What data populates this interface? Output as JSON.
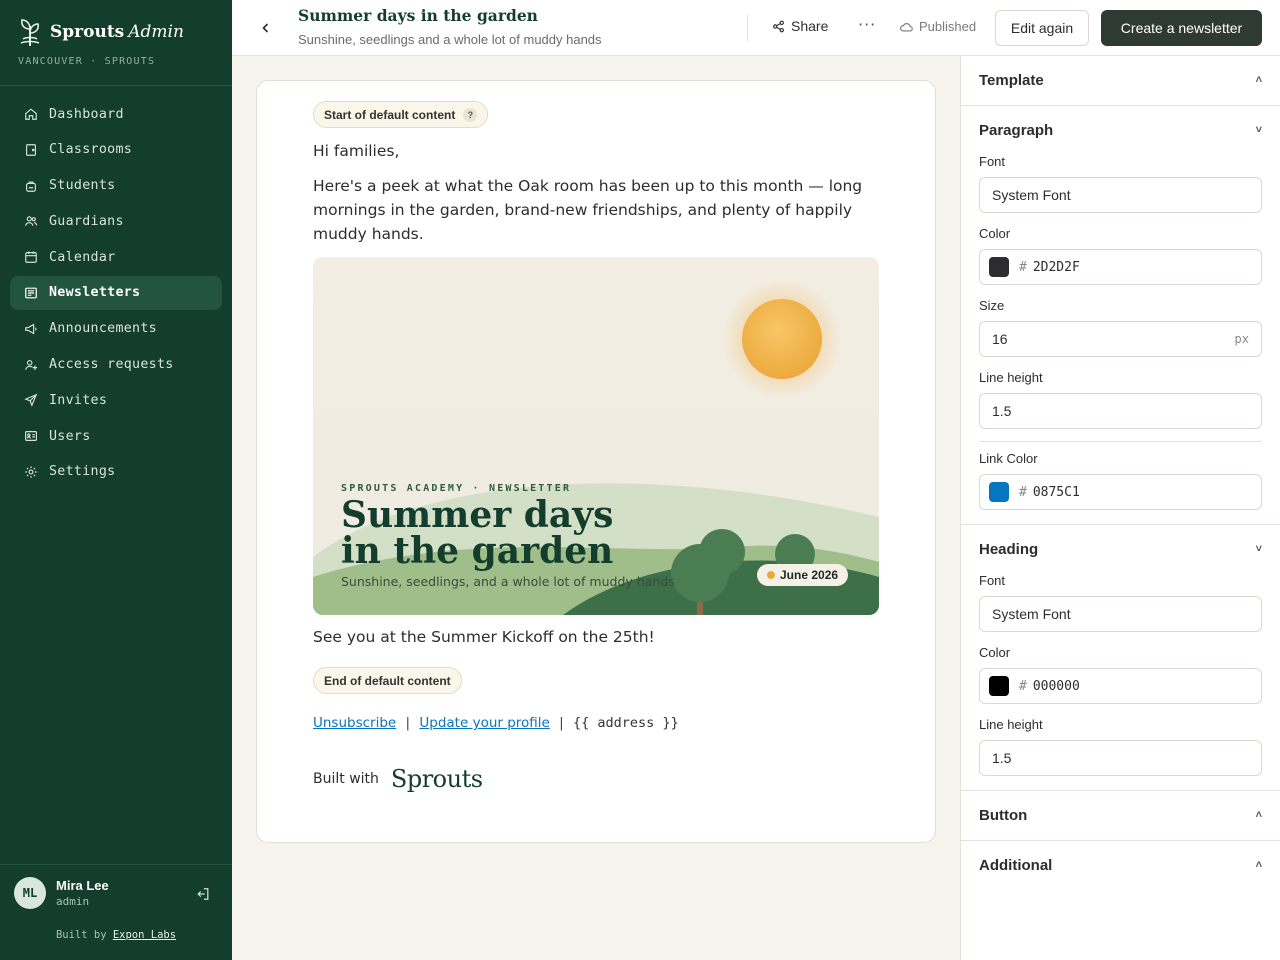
{
  "brand": {
    "name": "Sprouts",
    "name_suffix": "Admin",
    "location": "VANCOUVER · SPROUTS"
  },
  "sidebar": {
    "items": [
      {
        "label": "Dashboard",
        "icon": "home-icon",
        "active": false
      },
      {
        "label": "Classrooms",
        "icon": "door-icon",
        "active": false
      },
      {
        "label": "Students",
        "icon": "backpack-icon",
        "active": false
      },
      {
        "label": "Guardians",
        "icon": "users-icon",
        "active": false
      },
      {
        "label": "Calendar",
        "icon": "calendar-icon",
        "active": false
      },
      {
        "label": "Newsletters",
        "icon": "newspaper-icon",
        "active": true
      },
      {
        "label": "Announcements",
        "icon": "megaphone-icon",
        "active": false
      },
      {
        "label": "Access requests",
        "icon": "user-plus-icon",
        "active": false
      },
      {
        "label": "Invites",
        "icon": "send-icon",
        "active": false
      },
      {
        "label": "Users",
        "icon": "id-card-icon",
        "active": false
      },
      {
        "label": "Settings",
        "icon": "gear-icon",
        "active": false
      }
    ]
  },
  "user": {
    "initials": "ML",
    "name": "Mira Lee",
    "role": "admin"
  },
  "footer": {
    "built_by": "Built by",
    "company": "Expon Labs"
  },
  "header": {
    "title": "Summer days in the garden",
    "subtitle": "Sunshine, seedlings and a whole lot of muddy hands",
    "share_label": "Share",
    "more_label": "···",
    "status_label": "Published",
    "edit_label": "Edit again",
    "create_label": "Create a newsletter"
  },
  "content": {
    "start_marker": "Start of default content",
    "help_mark": "?",
    "greeting": "Hi families,",
    "body": "Here's a peek at what the Oak room has been up to this month — long mornings in the garden, brand-new friendships, and plenty of happily muddy hands.",
    "hero": {
      "kicker": "SPROUTS ACADEMY · NEWSLETTER",
      "title_line1": "Summer days",
      "title_line2": "in the garden",
      "subtitle": "Sunshine, seedlings, and a whole lot of muddy hands",
      "badge": "June 2026"
    },
    "closing": "See you at the Summer Kickoff on the 25th!",
    "end_marker": "End of default content",
    "unsubscribe": "Unsubscribe",
    "separator": "|",
    "update_profile": "Update your profile",
    "address_tag": "{{ address }}",
    "built_with": "Built with",
    "built_logo": "Sprouts"
  },
  "panel": {
    "template": {
      "title": "Template",
      "chevron": "˄"
    },
    "paragraph": {
      "title": "Paragraph",
      "chevron": "˅",
      "font_label": "Font",
      "font_value": "System Font",
      "color_label": "Color",
      "color_hash": "#",
      "color_value": "2D2D2F",
      "color_swatch": "#2D2D2F",
      "size_label": "Size",
      "size_value": "16",
      "size_unit": "px",
      "line_height_label": "Line height",
      "line_height_value": "1.5",
      "link_color_label": "Link Color",
      "link_color_value": "0875C1",
      "link_color_swatch": "#0875C1"
    },
    "heading": {
      "title": "Heading",
      "chevron": "˅",
      "font_label": "Font",
      "font_value": "System Font",
      "color_label": "Color",
      "color_hash": "#",
      "color_value": "000000",
      "color_swatch": "#000000",
      "line_height_label": "Line height",
      "line_height_value": "1.5"
    },
    "button": {
      "title": "Button",
      "chevron": "˄"
    },
    "additional": {
      "title": "Additional",
      "chevron": "˄"
    }
  },
  "colors": {
    "sidebar_bg": "#133D2C",
    "active_item": "#225440",
    "primary_button": "#2F3A35",
    "link": "#0875C1",
    "page_bg": "#F7F4EE"
  }
}
